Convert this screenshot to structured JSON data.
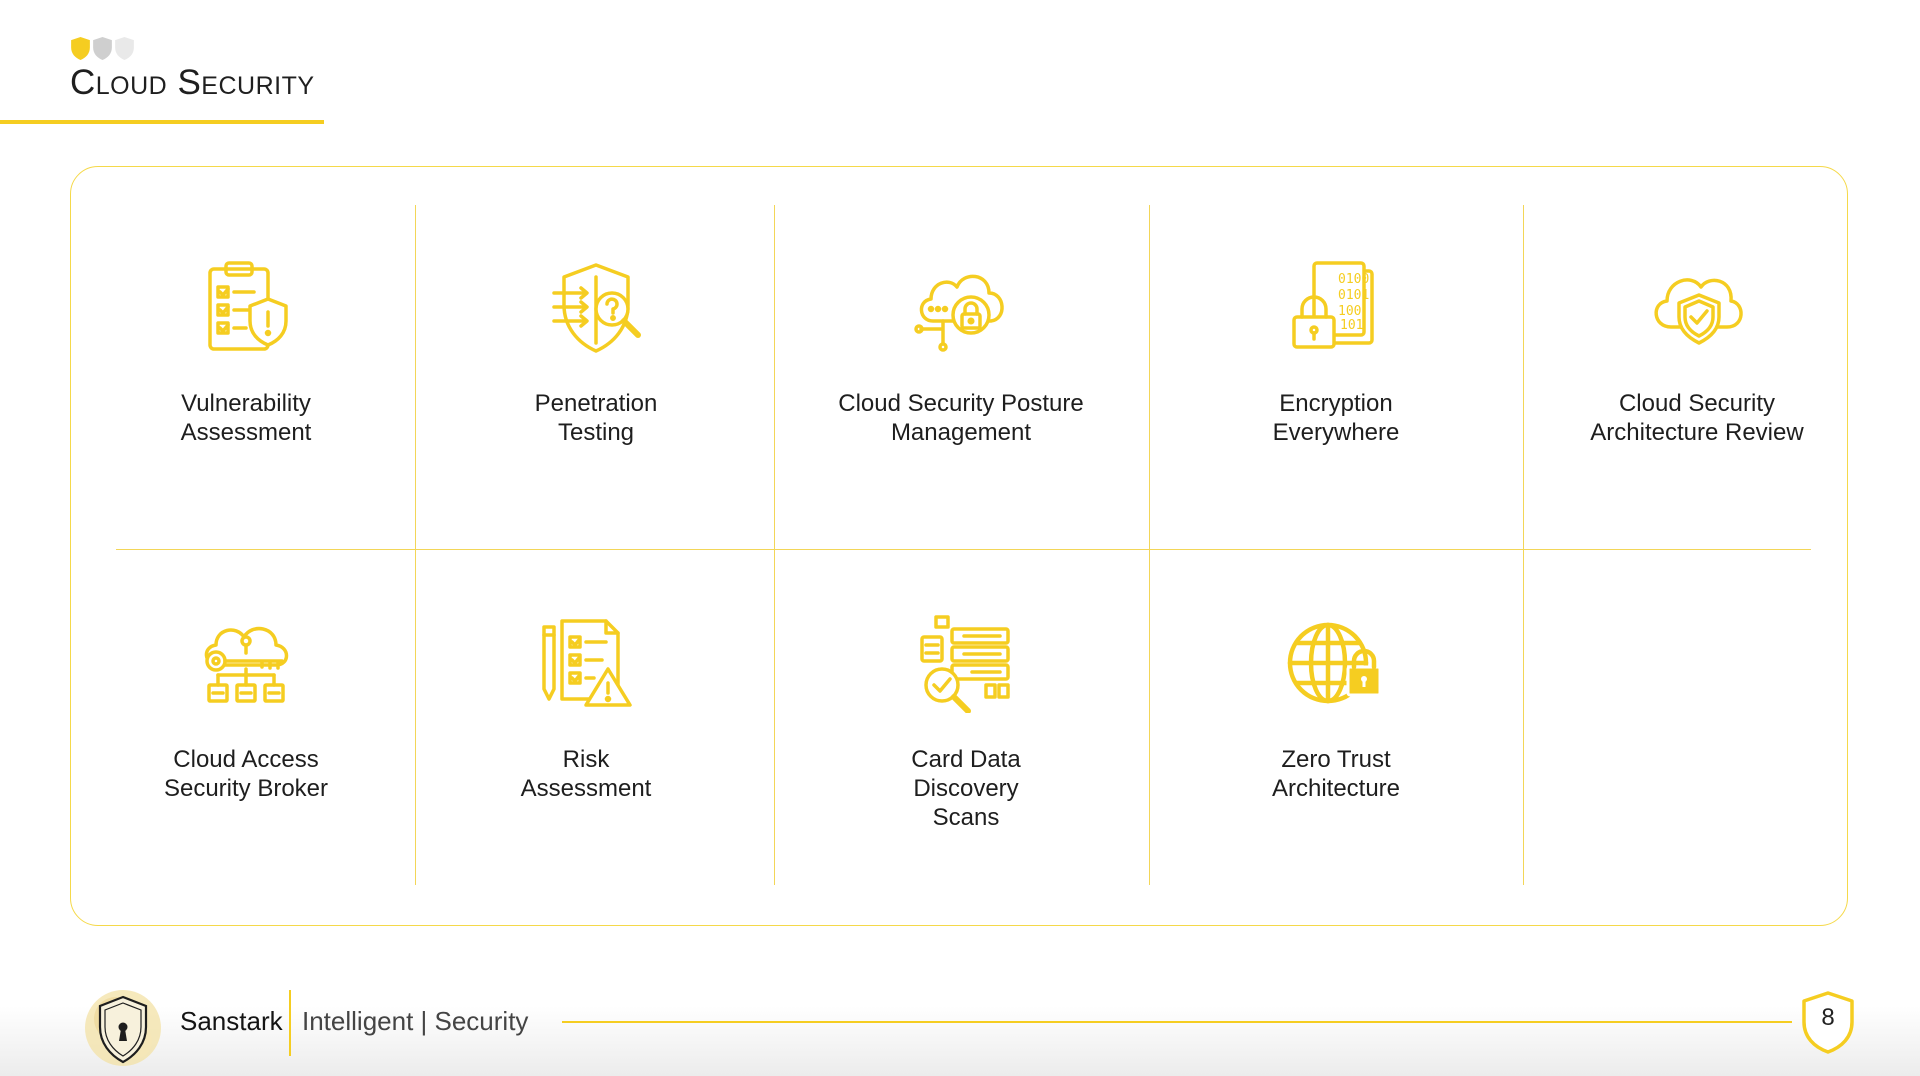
{
  "title": "Cloud Security",
  "services": [
    {
      "label": "Vulnerability\nAssessment",
      "icon": "clipboard-shield-icon"
    },
    {
      "label": "Penetration\nTesting",
      "icon": "shield-search-icon"
    },
    {
      "label": "Cloud Security Posture\nManagement",
      "icon": "cloud-lock-icon"
    },
    {
      "label": "Encryption\nEverywhere",
      "icon": "binary-file-lock-icon"
    },
    {
      "label": "Cloud Security\nArchitecture Review",
      "icon": "cloud-shield-check-icon"
    },
    {
      "label": "Cloud Access\nSecurity Broker",
      "icon": "cloud-key-network-icon"
    },
    {
      "label": "Risk\nAssessment",
      "icon": "document-warning-icon"
    },
    {
      "label": "Card Data\nDiscovery\nScans",
      "icon": "database-search-icon"
    },
    {
      "label": "Zero Trust\nArchitecture",
      "icon": "globe-lock-icon"
    }
  ],
  "footer": {
    "brand": "Sanstark",
    "tagline": "Intelligent | Security",
    "page_number": "8"
  },
  "colors": {
    "accent": "#f5cd21",
    "border": "#f5d94a",
    "text": "#1e1e1e"
  }
}
